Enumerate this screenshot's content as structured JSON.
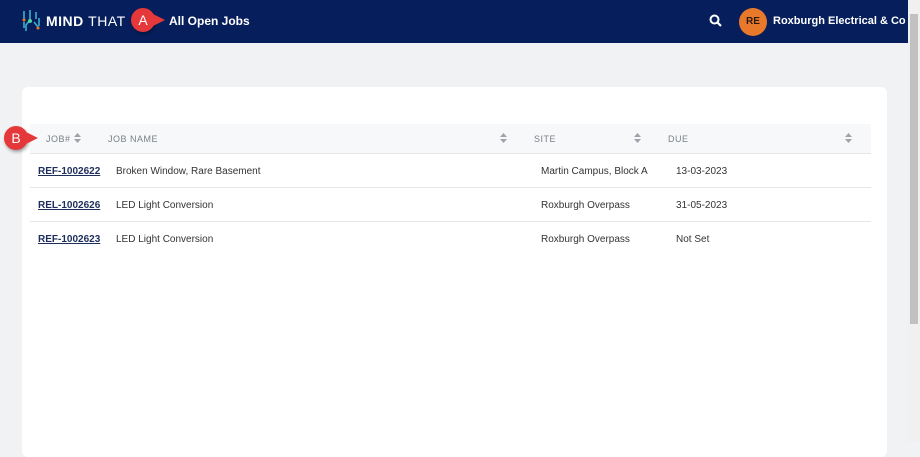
{
  "header": {
    "brand_bold": "MIND",
    "brand_thin": "THAT",
    "page_title": "All Open Jobs",
    "avatar_initials": "RE",
    "company": "Roxburgh Electrical & Co"
  },
  "callouts": {
    "a": "A",
    "b": "B"
  },
  "table": {
    "columns": [
      "JOB#",
      "JOB NAME",
      "SITE",
      "DUE"
    ],
    "rows": [
      {
        "ref": "REF-1002622",
        "name": "Broken Window, Rare Basement",
        "site": "Martin Campus, Block A",
        "due": "13-03-2023"
      },
      {
        "ref": "REL-1002626",
        "name": "LED Light Conversion",
        "site": "Roxburgh Overpass",
        "due": "31-05-2023"
      },
      {
        "ref": "REF-1002623",
        "name": "LED Light Conversion",
        "site": "Roxburgh Overpass",
        "due": "Not Set"
      }
    ]
  },
  "colors": {
    "nav": "#061f5c",
    "accent": "#e8782a",
    "callout": "#e5383b"
  }
}
